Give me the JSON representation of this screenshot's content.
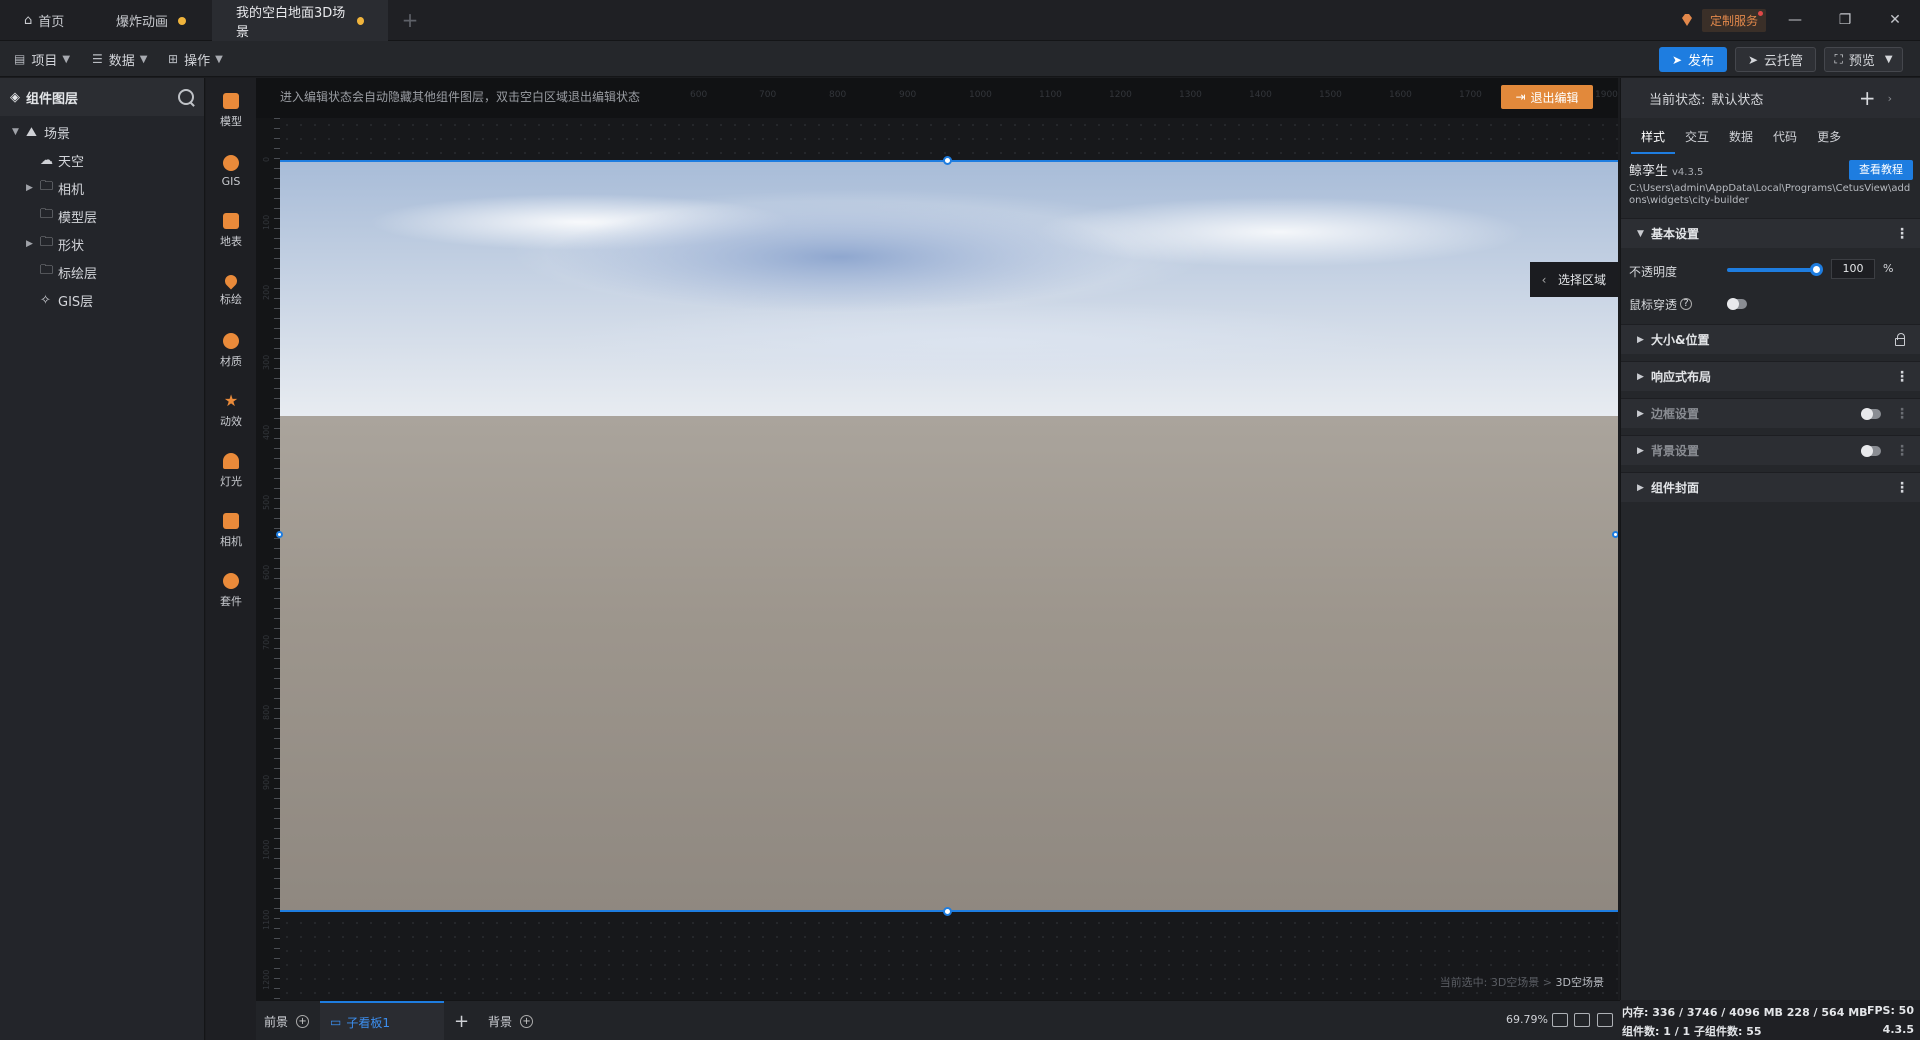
{
  "titlebar": {
    "tabs": [
      {
        "label": "首页",
        "icon": "home-icon"
      },
      {
        "label": "爆炸动画",
        "unsaved": true
      },
      {
        "label": "我的空白地面3D场景",
        "unsaved": true,
        "active": true
      }
    ],
    "custom_service": "定制服务"
  },
  "toolbar": {
    "menus": [
      "项目",
      "数据",
      "操作"
    ],
    "publish": "发布",
    "cloud": "云托管",
    "preview": "预览"
  },
  "layers": {
    "title": "组件图层",
    "items": [
      {
        "label": "场景",
        "icon": "mountain-icon"
      },
      {
        "label": "天空",
        "icon": "cloud-icon"
      },
      {
        "label": "相机",
        "icon": "folder-icon"
      },
      {
        "label": "模型层",
        "icon": "folder-icon"
      },
      {
        "label": "形状",
        "icon": "folder-icon"
      },
      {
        "label": "标绘层",
        "icon": "folder-icon"
      },
      {
        "label": "GIS层",
        "icon": "gis-icon"
      }
    ]
  },
  "tools": [
    "模型",
    "GIS",
    "地表",
    "标绘",
    "材质",
    "动效",
    "灯光",
    "相机",
    "套件"
  ],
  "canvas": {
    "hint": "进入编辑状态会自动隐藏其他组件图层，双击空白区域退出编辑状态",
    "ruler_h": [
      "600",
      "700",
      "800",
      "900",
      "1000",
      "1100",
      "1200",
      "1300",
      "1400",
      "1500",
      "1600",
      "1700",
      "1800",
      "1900"
    ],
    "ruler_v": [
      "0",
      "100",
      "200",
      "300",
      "400",
      "500",
      "600",
      "700",
      "800",
      "900",
      "1000",
      "1100",
      "1200"
    ],
    "exit_edit": "退出编辑",
    "select_area": "选择区域",
    "status_prefix": "当前选中: 3D空场景 > ",
    "status_current": "3D空场景"
  },
  "bottom": {
    "front": "前景",
    "board": "子看板1",
    "background": "背景",
    "zoom": "69.79%"
  },
  "props": {
    "state_label": "当前状态:",
    "state_value": "默认状态",
    "tabs": [
      "样式",
      "交互",
      "数据",
      "代码",
      "更多"
    ],
    "component_name": "鲸孪生",
    "component_version": "v4.3.5",
    "tutorial": "查看教程",
    "component_path": "C:\\Users\\admin\\AppData\\Local\\Programs\\CetusView\\addons\\widgets\\city-builder",
    "sections": {
      "basic": "基本设置",
      "size": "大小&位置",
      "responsive": "响应式布局",
      "border": "边框设置",
      "background": "背景设置",
      "cover": "组件封面"
    },
    "opacity_label": "不透明度",
    "opacity_value": "100",
    "opacity_unit": "%",
    "mouse_through": "鼠标穿透"
  },
  "status": {
    "memory": "内存:  336 / 3746 / 4096 MB  228 / 564 MB",
    "fps": "FPS:  50",
    "components": "组件数: 1 / 1   子组件数: 55",
    "version": "4.3.5"
  }
}
